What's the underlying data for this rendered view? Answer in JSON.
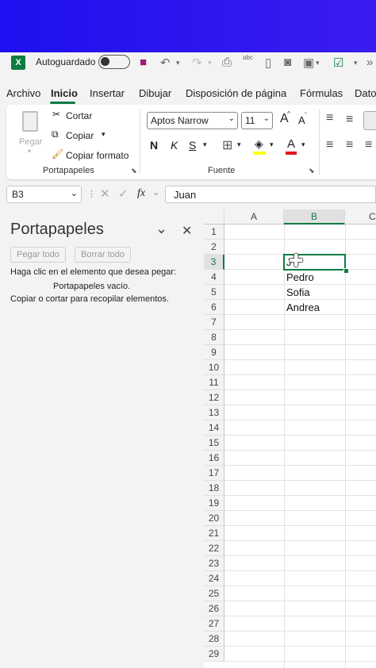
{
  "quick_access": {
    "app_icon": "excel-logo-icon",
    "autosave_label": "Autoguardado"
  },
  "menu": {
    "tabs": [
      "Archivo",
      "Inicio",
      "Insertar",
      "Dibujar",
      "Disposición de página",
      "Fórmulas",
      "Dato"
    ],
    "active": "Inicio"
  },
  "ribbon": {
    "clipboard": {
      "paste_label": "Pegar",
      "cut_label": "Cortar",
      "copy_label": "Copiar",
      "format_painter_label": "Copiar formato",
      "group_label": "Portapapeles"
    },
    "font": {
      "font_name": "Aptos Narrow",
      "font_size": "11",
      "bold": "N",
      "italic": "K",
      "underline": "S",
      "grow": "A",
      "shrink": "A",
      "font_color_glyph": "A",
      "group_label": "Fuente",
      "fill_color": "#ffff00",
      "font_color": "#e81123"
    }
  },
  "formula_bar": {
    "name_box": "B3",
    "fx": "fx",
    "value": "Juan"
  },
  "clipboard_pane": {
    "title": "Portapapeles",
    "paste_all": "Pegar todo",
    "clear_all": "Borrar todo",
    "instruction": "Haga clic en el elemento que desea pegar:",
    "empty": "Portapapeles vacío.",
    "hint": "Copiar o cortar para recopilar elementos."
  },
  "sheet": {
    "columns": [
      "A",
      "B",
      "C"
    ],
    "rows": [
      "1",
      "2",
      "3",
      "4",
      "5",
      "6",
      "7",
      "8",
      "9",
      "10",
      "11",
      "12",
      "13",
      "14",
      "15",
      "16",
      "17",
      "18",
      "19",
      "20",
      "21",
      "22",
      "23",
      "24",
      "25",
      "26",
      "27",
      "28",
      "29"
    ],
    "cells": {
      "B3": "J",
      "B4": "Pedro",
      "B5": "Sofia",
      "B6": "Andrea"
    },
    "selected_cell": "B3",
    "accent": "#107c41"
  }
}
